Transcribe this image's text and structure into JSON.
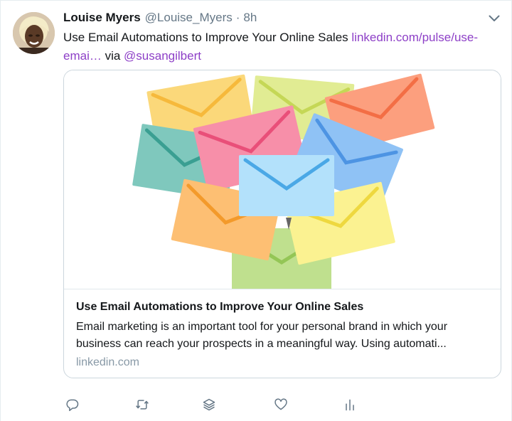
{
  "tweet": {
    "author_name": "Louise Myers",
    "author_handle": "@Louise_Myers",
    "separator": "·",
    "time": "8h",
    "text_before": "Use Email Automations to Improve Your Online Sales ",
    "link_text": "linkedin.com/pulse/use-emai…",
    "text_via": " via ",
    "mention": "@susangilbert",
    "link_color": "#8d3fc7"
  },
  "card": {
    "title": "Use Email Automations to Improve Your Online Sales",
    "description": "Email marketing is an important tool for your personal brand in which your business can reach your prospects in a meaningful way. Using automati...",
    "domain": "linkedin.com"
  },
  "icons": {
    "caret": "chevron-down-icon",
    "reply": "reply-icon",
    "retweet": "retweet-icon",
    "stack": "layers-icon",
    "like": "heart-icon",
    "analytics": "analytics-icon"
  },
  "envelope_colors": {
    "yellow": "#fbd87a",
    "lime": "#e1ec93",
    "salmon": "#fc9f7e",
    "teal": "#7fc8bd",
    "pink": "#f78fa9",
    "blue": "#8fc2f5",
    "lightblue": "#b3e1fb",
    "orange": "#fdbf73",
    "paleyellow": "#fbf291",
    "green": "#bfe08e"
  }
}
